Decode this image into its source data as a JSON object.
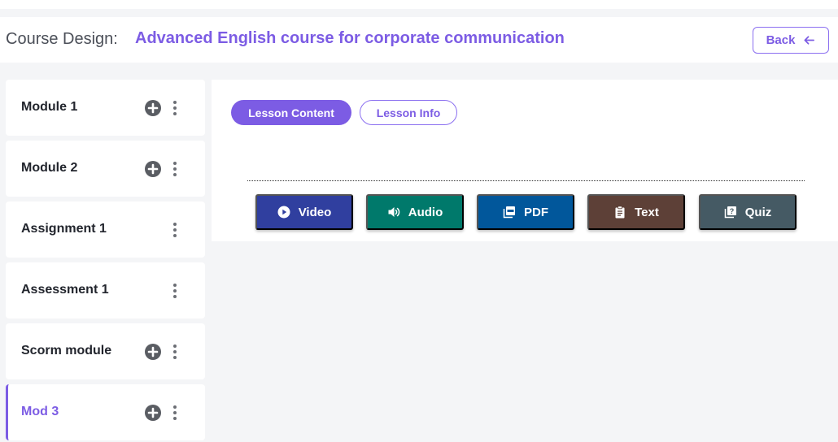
{
  "header": {
    "crumb": "Course Design:",
    "title": "Advanced English course for corporate communication",
    "back_label": "Back"
  },
  "sidebar": {
    "items": [
      {
        "label": "Module 1",
        "has_add": true
      },
      {
        "label": "Module 2",
        "has_add": true
      },
      {
        "label": "Assignment 1",
        "has_add": false
      },
      {
        "label": "Assessment 1",
        "has_add": false
      },
      {
        "label": "Scorm module",
        "has_add": true
      },
      {
        "label": "Mod 3",
        "has_add": true,
        "active": true
      }
    ]
  },
  "tabs": {
    "content_label": "Lesson Content",
    "info_label": "Lesson Info"
  },
  "content_types": [
    {
      "label": "Video",
      "icon": "play-circle-icon",
      "color": "#303f9f"
    },
    {
      "label": "Audio",
      "icon": "volume-icon",
      "color": "#00796b"
    },
    {
      "label": "PDF",
      "icon": "pdf-icon",
      "color": "#01579b"
    },
    {
      "label": "Text",
      "icon": "clipboard-icon",
      "color": "#5d4037"
    },
    {
      "label": "Quiz",
      "icon": "quiz-icon",
      "color": "#455a64"
    }
  ],
  "colors": {
    "accent": "#7c5ce4",
    "background": "#f4f5f7"
  }
}
